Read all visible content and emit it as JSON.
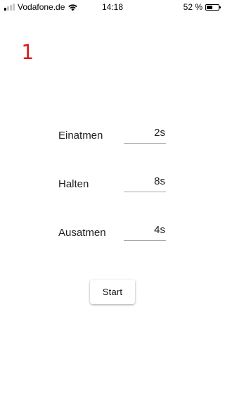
{
  "status_bar": {
    "carrier": "Vodafone.de",
    "time": "14:18",
    "battery_text": "52 %",
    "battery_level": 0.52,
    "signal_bars_active": 1,
    "signal_bars_total": 4
  },
  "counter": {
    "value": "1",
    "color": "#d91b1b"
  },
  "fields": [
    {
      "label": "Einatmen",
      "value": "2s"
    },
    {
      "label": "Halten",
      "value": "8s"
    },
    {
      "label": "Ausatmen",
      "value": "4s"
    }
  ],
  "start_button": {
    "label": "Start"
  }
}
